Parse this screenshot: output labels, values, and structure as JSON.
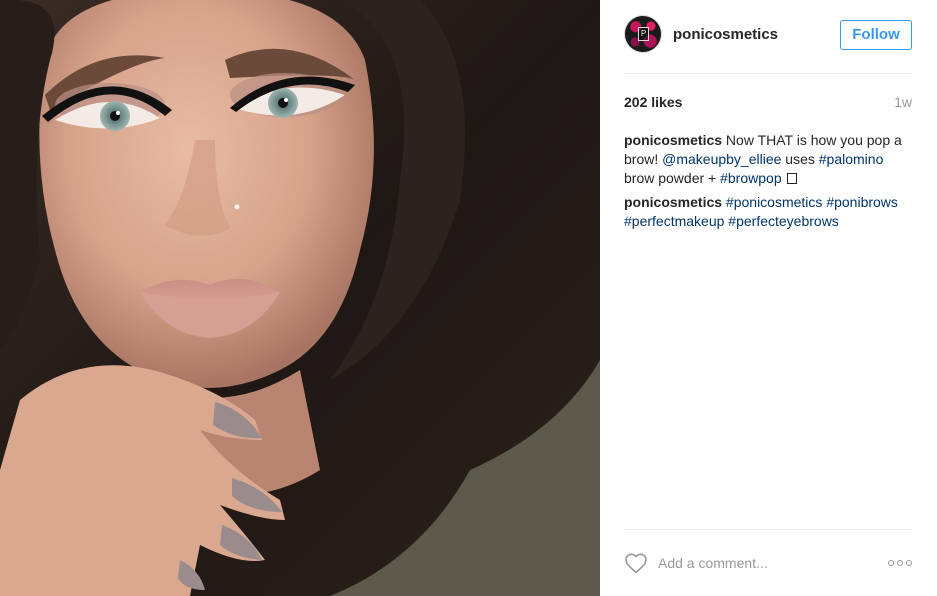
{
  "post": {
    "author": "ponicosmetics",
    "follow_label": "Follow",
    "likes": "202 likes",
    "age": "1w",
    "caption": {
      "line1": {
        "user": "ponicosmetics",
        "text_a": " Now THAT is how you pop a brow! ",
        "mention": "@makeupby_elliee",
        "text_b": " uses ",
        "tag1": "#palomino",
        "text_c": " brow powder + ",
        "tag2": "#browpop"
      },
      "line2": {
        "user": "ponicosmetics",
        "tags": [
          "#ponicosmetics",
          "#ponibrows",
          "#perfectmakeup",
          "#perfecteyebrows"
        ]
      }
    },
    "comment_placeholder": "Add a comment...",
    "icons": {
      "like": "heart-outline-icon",
      "more": "more-options-icon"
    },
    "colors": {
      "link": "#003569",
      "accent": "#3897f0",
      "muted": "#999999"
    }
  }
}
